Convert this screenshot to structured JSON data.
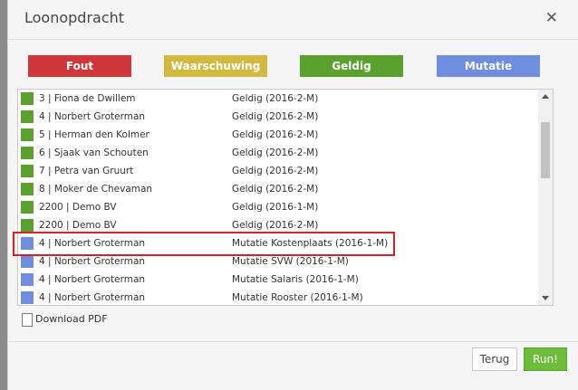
{
  "dialog": {
    "title": "Loonopdracht"
  },
  "legend": [
    {
      "label": "Fout",
      "color": "#d1363a"
    },
    {
      "label": "Waarschuwing",
      "color": "#d4b940"
    },
    {
      "label": "Geldig",
      "color": "#5aa12f"
    },
    {
      "label": "Mutatie",
      "color": "#6f8ee0"
    }
  ],
  "rows": [
    {
      "id": "3 | Fiona de Dwillem",
      "status": "Geldig (2016-2-M)",
      "color": "#5aa12f"
    },
    {
      "id": "4 | Norbert Groterman",
      "status": "Geldig (2016-2-M)",
      "color": "#5aa12f"
    },
    {
      "id": "5 | Herman den Kolmer",
      "status": "Geldig (2016-2-M)",
      "color": "#5aa12f"
    },
    {
      "id": "6 | Sjaak van Schouten",
      "status": "Geldig (2016-2-M)",
      "color": "#5aa12f"
    },
    {
      "id": "7 | Petra van Gruurt",
      "status": "Geldig (2016-2-M)",
      "color": "#5aa12f"
    },
    {
      "id": "8 | Moker de Chevaman",
      "status": "Geldig (2016-2-M)",
      "color": "#5aa12f"
    },
    {
      "id": "2200 | Demo BV",
      "status": "Geldig (2016-1-M)",
      "color": "#5aa12f"
    },
    {
      "id": "2200 | Demo BV",
      "status": "Geldig (2016-2-M)",
      "color": "#5aa12f"
    },
    {
      "id": "4 | Norbert Groterman",
      "status": "Mutatie Kostenplaats (2016-1-M)",
      "color": "#6f8ee0"
    },
    {
      "id": "4 | Norbert Groterman",
      "status": "Mutatie SVW (2016-1-M)",
      "color": "#6f8ee0"
    },
    {
      "id": "4 | Norbert Groterman",
      "status": "Mutatie Salaris (2016-1-M)",
      "color": "#6f8ee0"
    },
    {
      "id": "4 | Norbert Groterman",
      "status": "Mutatie Rooster (2016-1-M)",
      "color": "#6f8ee0"
    }
  ],
  "download": {
    "label": "Download PDF"
  },
  "buttons": {
    "back": "Terug",
    "run": "Run!"
  }
}
